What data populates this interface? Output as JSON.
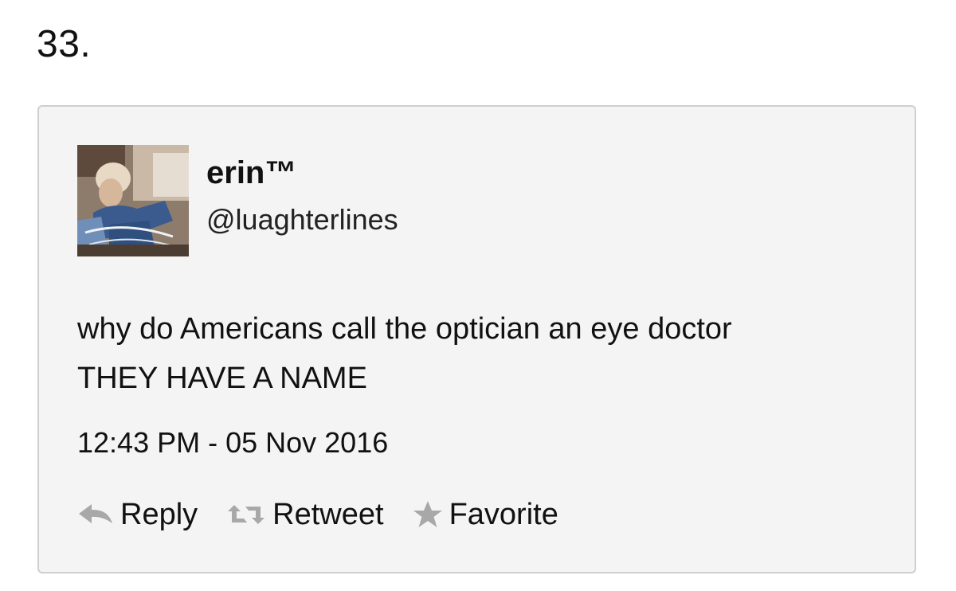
{
  "list_number": "33.",
  "tweet": {
    "display_name": "erin™",
    "handle": "@luaghterlines",
    "text_line1": "why do Americans call the optician an eye doctor",
    "text_line2": "THEY HAVE A NAME",
    "timestamp": "12:43 PM - 05 Nov 2016",
    "actions": [
      {
        "label": "Reply",
        "icon": "reply-icon"
      },
      {
        "label": "Retweet",
        "icon": "retweet-icon"
      },
      {
        "label": "Favorite",
        "icon": "star-icon"
      }
    ]
  },
  "colors": {
    "card_background": "#f4f4f4",
    "card_border": "#cfcfcf",
    "icon_gray": "#a8a8a8",
    "text": "#111111"
  }
}
